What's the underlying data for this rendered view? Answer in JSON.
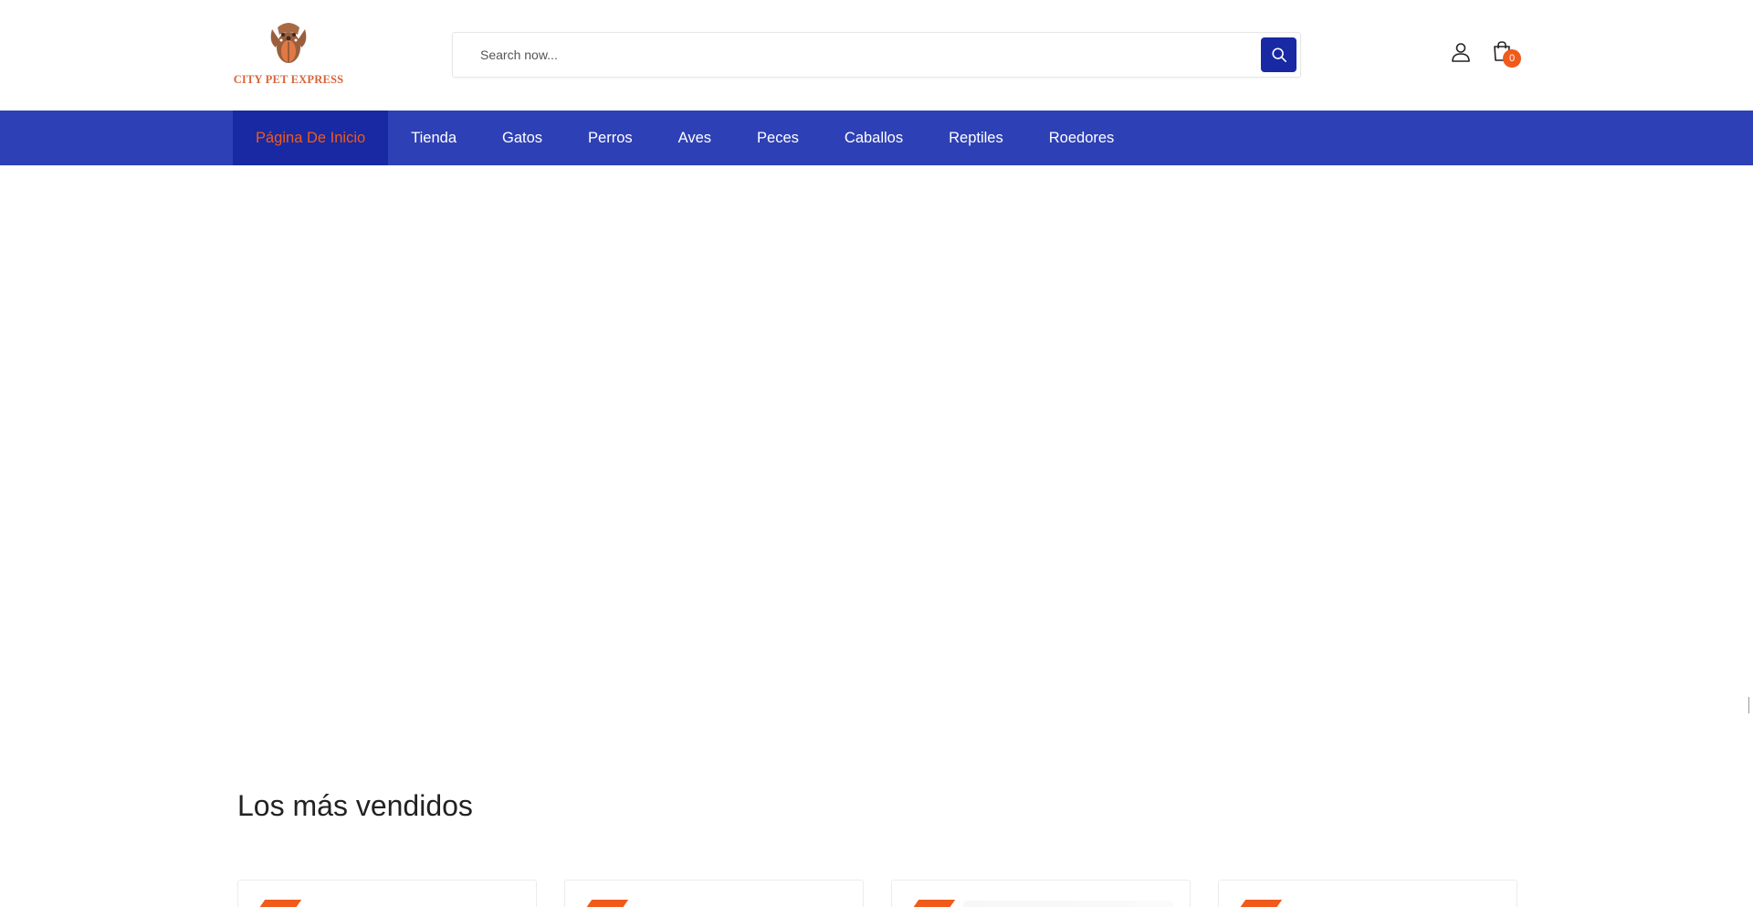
{
  "header": {
    "logo_text": "CITY PET EXPRESS",
    "brand_color": "#d8643a",
    "search": {
      "placeholder": "Search now...",
      "value": "",
      "button_icon": "search-icon",
      "button_color": "#1829a3"
    },
    "account_icon": "user-icon",
    "cart": {
      "icon": "shopping-bag-icon",
      "count": "0",
      "badge_color": "#f05a1a"
    }
  },
  "nav": {
    "background": "#2e40b5",
    "active_background": "#1829a3",
    "active_color": "#f05a1a",
    "items": [
      {
        "label": "Página De Inicio",
        "active": true
      },
      {
        "label": "Tienda",
        "active": false
      },
      {
        "label": "Gatos",
        "active": false
      },
      {
        "label": "Perros",
        "active": false
      },
      {
        "label": "Aves",
        "active": false
      },
      {
        "label": "Peces",
        "active": false
      },
      {
        "label": "Caballos",
        "active": false
      },
      {
        "label": "Reptiles",
        "active": false
      },
      {
        "label": "Roedores",
        "active": false
      }
    ]
  },
  "bestsellers": {
    "title": "Los más vendidos",
    "product_cards": 4
  }
}
